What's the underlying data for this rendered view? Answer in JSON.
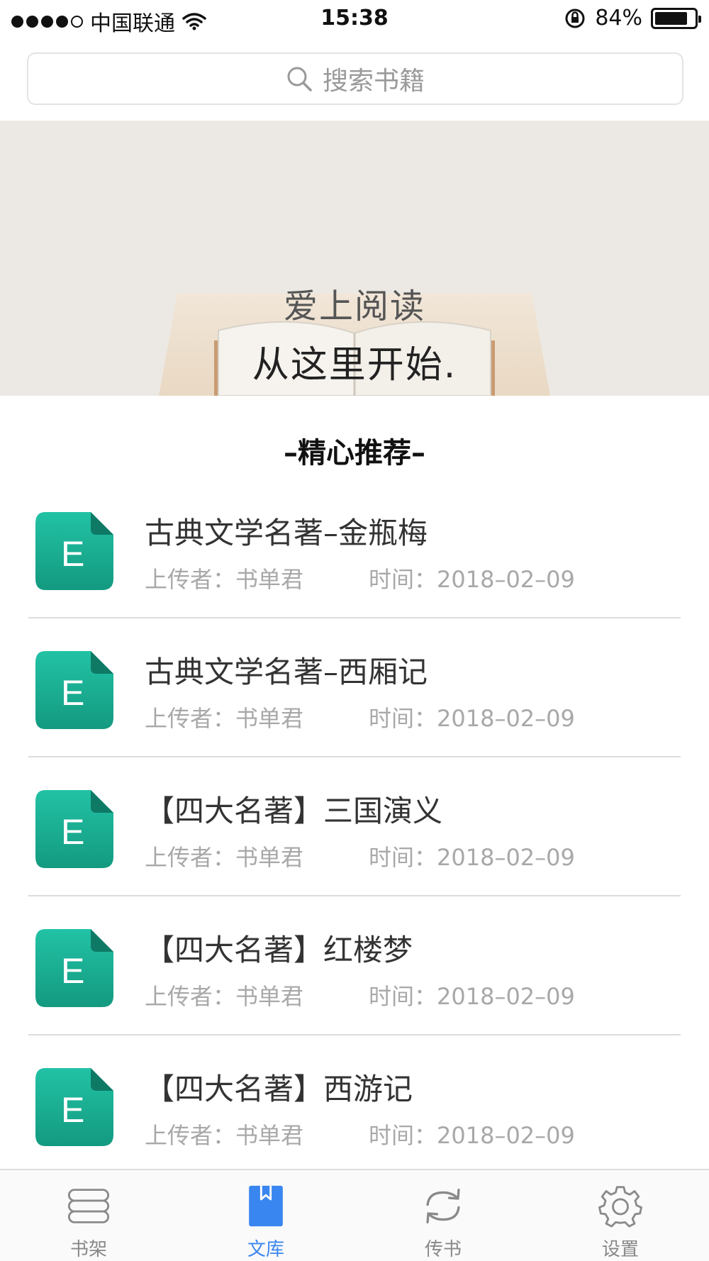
{
  "status_bar": {
    "carrier": "中国联通",
    "time": "15:38",
    "battery": "84%",
    "battery_level": 0.84
  },
  "search": {
    "placeholder": "搜索书籍"
  },
  "banner": {
    "line1": "爱上阅读",
    "line2": "从这里开始."
  },
  "section": {
    "title": "–精心推荐–"
  },
  "books": [
    {
      "title": "古典文学名著–金瓶梅",
      "uploader": "上传者：书单君",
      "time": "时间：2018–02–09",
      "icon": "E"
    },
    {
      "title": "古典文学名著–西厢记",
      "uploader": "上传者：书单君",
      "time": "时间：2018–02–09",
      "icon": "E"
    },
    {
      "title": "【四大名著】三国演义",
      "uploader": "上传者：书单君",
      "time": "时间：2018–02–09",
      "icon": "E"
    },
    {
      "title": "【四大名著】红楼梦",
      "uploader": "上传者：书单君",
      "time": "时间：2018–02–09",
      "icon": "E"
    },
    {
      "title": "【四大名著】西游记",
      "uploader": "上传者：书单君",
      "time": "时间：2018–02–09",
      "icon": "E"
    }
  ],
  "tabs": [
    {
      "label": "书架",
      "icon": "bookshelf-icon",
      "active": false
    },
    {
      "label": "文库",
      "icon": "library-icon",
      "active": true
    },
    {
      "label": "传书",
      "icon": "transfer-icon",
      "active": false
    },
    {
      "label": "设置",
      "icon": "settings-gear-icon",
      "active": false
    }
  ],
  "colors": {
    "accent": "#3a86f0",
    "book_icon": "#1aa98e"
  }
}
